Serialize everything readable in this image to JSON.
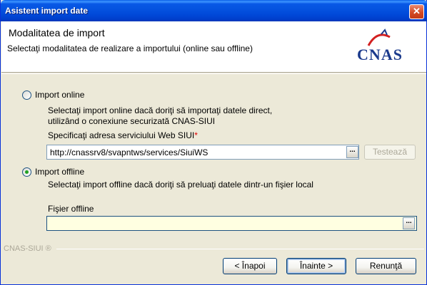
{
  "window": {
    "title": "Asistent import date",
    "close_glyph": "✕"
  },
  "header": {
    "title": "Modalitatea de import",
    "subtitle": "Selectaţi modalitatea de realizare a importului (online sau offline)",
    "logo_text": "CNAS",
    "logo_colors": {
      "text": "#1B3A8C",
      "arc": "#D32020"
    }
  },
  "online": {
    "label": "Import online",
    "selected": false,
    "description_line1": "Selectaţi import online dacă doriţi să importaţi datele direct,",
    "description_line2": " utilizând o conexiune securizată CNAS-SIUI",
    "url_label": "Specificaţi adresa serviciului Web SIUI",
    "required_mark": "*",
    "url_value": "http://cnassrv8/svapntws/services/SiuiWS",
    "browse_label": "...",
    "test_button": "Testează"
  },
  "offline": {
    "label": "Import offline",
    "selected": true,
    "description": "Selectaţi import offline dacă doriţi să preluaţi datele dintr-un fişier local",
    "file_label": "Fişier offline",
    "file_value": "",
    "browse_label": "..."
  },
  "footer": {
    "brand": "CNAS-SIUI ®",
    "back_button": "< Înapoi",
    "next_button": "Înainte >",
    "cancel_button": "Renunţă"
  }
}
